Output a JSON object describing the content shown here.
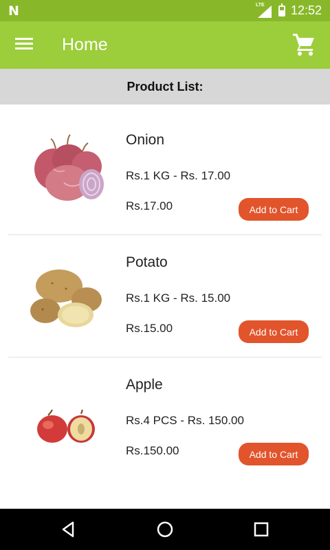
{
  "status_bar": {
    "logo": "N",
    "network": "LTE",
    "time": "12:52"
  },
  "app_bar": {
    "title": "Home",
    "menu_icon": "menu-icon",
    "cart_icon": "shopping-cart-icon"
  },
  "header": {
    "title": "Product List:"
  },
  "products": [
    {
      "name": "Onion",
      "description": "Rs.1 KG - Rs. 17.00",
      "price": "Rs.17.00",
      "button_label": "Add to Cart",
      "image_icon": "onion-image"
    },
    {
      "name": "Potato",
      "description": "Rs.1 KG - Rs. 15.00",
      "price": "Rs.15.00",
      "button_label": "Add to Cart",
      "image_icon": "potato-image"
    },
    {
      "name": "Apple",
      "description": "Rs.4 PCS - Rs. 150.00",
      "price": "Rs.150.00",
      "button_label": "Add to Cart",
      "image_icon": "apple-image"
    }
  ],
  "nav_bar": {
    "back_icon": "back-icon",
    "home_icon": "home-icon",
    "recents_icon": "recents-icon"
  },
  "colors": {
    "status_bar": "#88b829",
    "app_bar": "#9ccd3a",
    "header_bg": "#d7d7d7",
    "button": "#e2542b"
  }
}
